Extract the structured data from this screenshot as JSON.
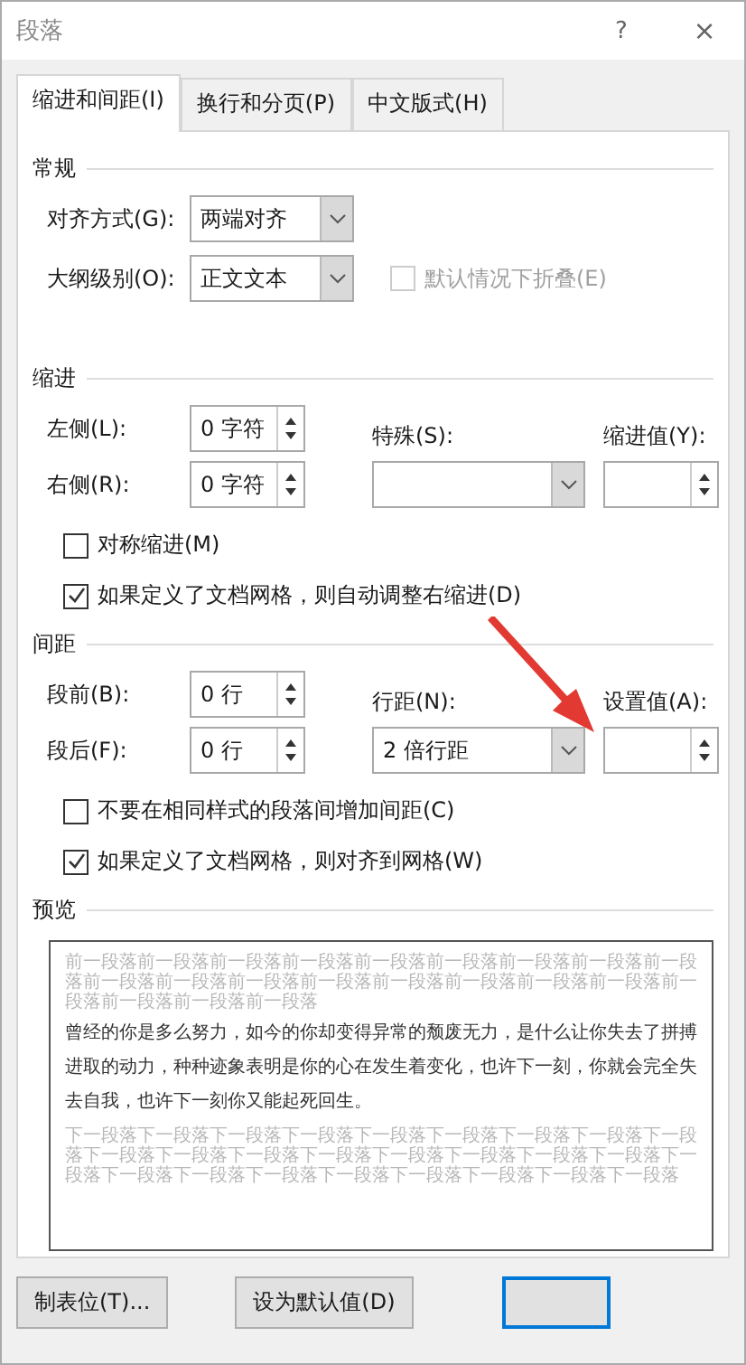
{
  "window": {
    "title": "段落",
    "help": "?",
    "close": "×"
  },
  "tabs": [
    {
      "label": "缩进和间距(I)",
      "selected": true
    },
    {
      "label": "换行和分页(P)",
      "selected": false
    },
    {
      "label": "中文版式(H)",
      "selected": false
    }
  ],
  "general": {
    "heading": "常规",
    "fields": [
      {
        "label": "对齐方式(G):",
        "value": "两端对齐"
      },
      {
        "label": "大纲级别(O):",
        "value": "正文文本"
      }
    ],
    "collapse": {
      "label": "默认情况下折叠(E)",
      "checked": false,
      "disabled": true
    }
  },
  "indent": {
    "heading": "缩进",
    "first": {
      "label": "左侧(L):",
      "value": "0 字符"
    },
    "second": {
      "label": "右侧(R):",
      "value": "0 字符"
    },
    "mode": {
      "label": "特殊(S):"
    },
    "amount": {
      "label": "缩进值(Y):"
    },
    "checks": [
      {
        "label": "对称缩进(M)",
        "checked": false
      },
      {
        "label": "如果定义了文档网格，则自动调整右缩进(D)",
        "checked": true
      }
    ]
  },
  "spacing": {
    "heading": "间距",
    "first": {
      "label": "段前(B):",
      "value": "0 行"
    },
    "second": {
      "label": "段后(F):",
      "value": "0 行"
    },
    "mode": {
      "label": "行距(N):",
      "value": "2 倍行距"
    },
    "amount": {
      "label": "设置值(A):"
    },
    "checks": [
      {
        "label": "不要在相同样式的段落间增加间距(C)",
        "checked": false
      },
      {
        "label": "如果定义了文档网格，则对齐到网格(W)",
        "checked": true
      }
    ]
  },
  "preview": {
    "heading": "预览",
    "previous": "前一段落前一段落前一段落前一段落前一段落前一段落前一段落前一段落前一段落前一段落前一段落前一段落前一段落前一段落前一段落前一段落前一段落前一段落前一段落前一段落前一段落",
    "sample": "曾经的你是多么努力，如今的你却变得异常的颓废无力，是什么让你失去了拼搏进取的动力，种种迹象表明是你的心在发生着变化，也许下一刻，你就会完全失去自我，也许下一刻你又能起死回生。",
    "next": "下一段落下一段落下一段落下一段落下一段落下一段落下一段落下一段落下一段落下一段落下一段落下一段落下一段落下一段落下一段落下一段落下一段落下一段落下一段落下一段落下一段落下一段落下一段落下一段落下一段落下一段落"
  },
  "buttons": [
    {
      "kind": "plain",
      "label": "制表位(T)..."
    },
    {
      "kind": "plain",
      "label": "设为默认值(D)"
    },
    {
      "kind": "default"
    }
  ]
}
